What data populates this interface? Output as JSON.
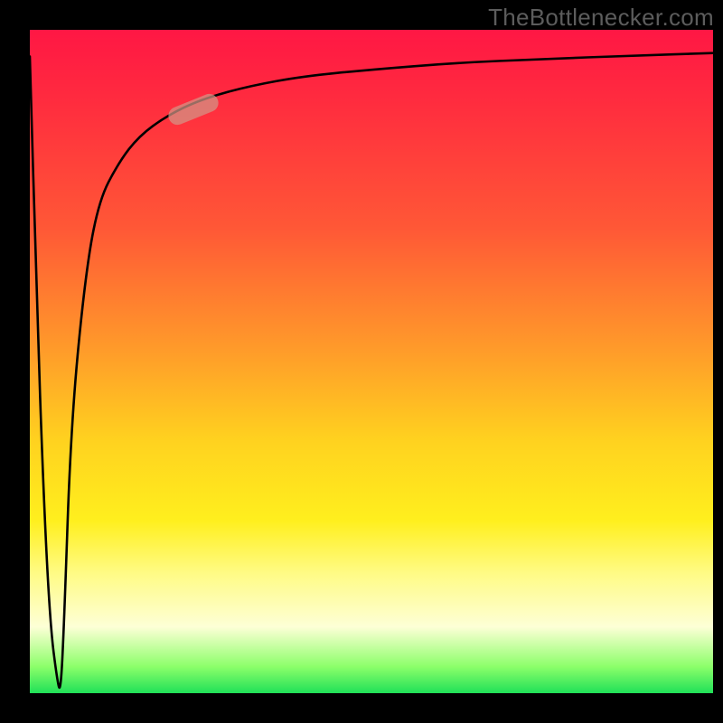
{
  "watermark": {
    "text": "TheBottlenecker.com"
  },
  "colors": {
    "frame_bg": "#000000",
    "grad_top": "#ff1744",
    "grad_mid1": "#ff9a2a",
    "grad_mid2": "#ffef1e",
    "grad_bottom": "#20e058",
    "curve": "#000000",
    "marker_fill": "rgba(210,150,135,0.72)"
  },
  "chart_data": {
    "type": "line",
    "title": "",
    "xlabel": "",
    "ylabel": "",
    "xlim": [
      0,
      100
    ],
    "ylim": [
      0,
      100
    ],
    "x": [
      0,
      1,
      2,
      3,
      4,
      4.5,
      5,
      6,
      8,
      10,
      13,
      16,
      20,
      25,
      32,
      40,
      50,
      62,
      75,
      88,
      100
    ],
    "values": [
      96,
      60,
      30,
      10,
      2,
      0,
      10,
      40,
      62,
      74,
      80,
      84,
      87,
      89.5,
      91.5,
      93,
      94,
      95,
      95.6,
      96.1,
      96.5
    ],
    "marker": {
      "x": 24,
      "y": 88,
      "angle_deg": 22
    }
  }
}
